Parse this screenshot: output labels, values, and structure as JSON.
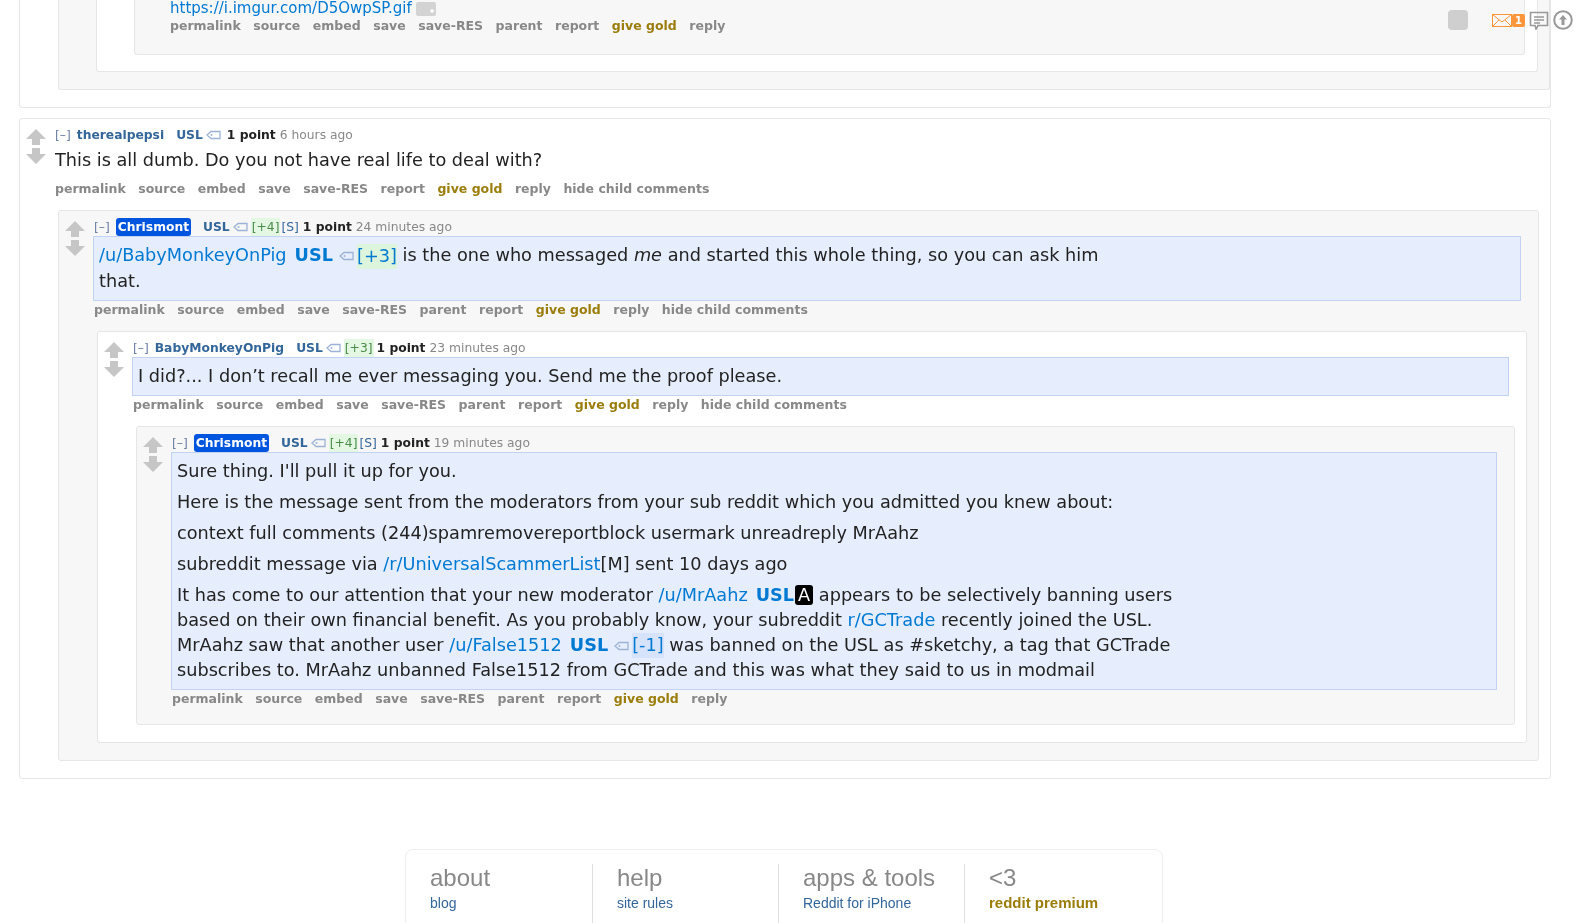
{
  "dock": {
    "mail_count": "1"
  },
  "previous_comment_tail": {
    "link": "https://i.imgur.com/D5OwpSP.gif",
    "actions": [
      {
        "text": "permalink",
        "kind": "plain"
      },
      {
        "text": "source",
        "kind": "plain"
      },
      {
        "text": "embed",
        "kind": "plain"
      },
      {
        "text": "save",
        "kind": "plain"
      },
      {
        "text": "save-RES",
        "kind": "plain"
      },
      {
        "text": "parent",
        "kind": "plain"
      },
      {
        "text": "report",
        "kind": "plain"
      },
      {
        "text": "give gold",
        "kind": "gold"
      },
      {
        "text": "reply",
        "kind": "plain"
      }
    ]
  },
  "comments": [
    {
      "collapse": "[–]",
      "author": "therealpepsi",
      "author_highlight": false,
      "flair": "USL",
      "score": "1 point",
      "time": "6 hours ago",
      "body_highlight": false,
      "body": [
        [
          {
            "kind": "text",
            "text": "This is all dumb. Do you not have real life to deal with?"
          }
        ]
      ],
      "actions": [
        {
          "text": "permalink",
          "kind": "plain"
        },
        {
          "text": "source",
          "kind": "plain"
        },
        {
          "text": "embed",
          "kind": "plain"
        },
        {
          "text": "save",
          "kind": "plain"
        },
        {
          "text": "save-RES",
          "kind": "plain"
        },
        {
          "text": "report",
          "kind": "plain"
        },
        {
          "text": "give gold",
          "kind": "gold"
        },
        {
          "text": "reply",
          "kind": "plain"
        },
        {
          "text": "hide child comments",
          "kind": "plain"
        }
      ],
      "children": [
        {
          "collapse": "[–]",
          "author": "Chrismont",
          "author_highlight": true,
          "flair": "USL",
          "karma": [
            {
              "text": "[+4]",
              "kind": "plus"
            },
            {
              "text": "[S]",
              "kind": "flag"
            }
          ],
          "score": "1 point",
          "time": "24 minutes ago",
          "body_highlight": true,
          "body": [
            [
              {
                "kind": "link",
                "text": "/u/BabyMonkeyOnPig"
              },
              {
                "kind": "flair",
                "text": "USL"
              },
              {
                "kind": "karma",
                "karma": {
                  "kind": "plus",
                  "text": "[+3]"
                }
              },
              {
                "kind": "text",
                "text": " is the one who messaged *me* and started this whole thing, so you can ask him that."
              }
            ]
          ],
          "actions": [
            {
              "text": "permalink",
              "kind": "plain"
            },
            {
              "text": "source",
              "kind": "plain"
            },
            {
              "text": "embed",
              "kind": "plain"
            },
            {
              "text": "save",
              "kind": "plain"
            },
            {
              "text": "save-RES",
              "kind": "plain"
            },
            {
              "text": "parent",
              "kind": "plain"
            },
            {
              "text": "report",
              "kind": "plain"
            },
            {
              "text": "give gold",
              "kind": "gold"
            },
            {
              "text": "reply",
              "kind": "plain"
            },
            {
              "text": "hide child comments",
              "kind": "plain"
            }
          ],
          "children": [
            {
              "collapse": "[–]",
              "author": "BabyMonkeyOnPig",
              "author_highlight": false,
              "flair": "USL",
              "karma": [
                {
                  "text": "[+3]",
                  "kind": "plus"
                }
              ],
              "score": "1 point",
              "time": "23 minutes ago",
              "body_highlight": true,
              "body": [
                [
                  {
                    "kind": "text",
                    "text": "I did?... I don’t recall me ever messaging you. Send me the proof please."
                  }
                ]
              ],
              "actions": [
                {
                  "text": "permalink",
                  "kind": "plain"
                },
                {
                  "text": "source",
                  "kind": "plain"
                },
                {
                  "text": "embed",
                  "kind": "plain"
                },
                {
                  "text": "save",
                  "kind": "plain"
                },
                {
                  "text": "save-RES",
                  "kind": "plain"
                },
                {
                  "text": "parent",
                  "kind": "plain"
                },
                {
                  "text": "report",
                  "kind": "plain"
                },
                {
                  "text": "give gold",
                  "kind": "gold"
                },
                {
                  "text": "reply",
                  "kind": "plain"
                },
                {
                  "text": "hide child comments",
                  "kind": "plain"
                }
              ],
              "children": [
                {
                  "collapse": "[–]",
                  "author": "Chrismont",
                  "author_highlight": true,
                  "flair": "USL",
                  "karma": [
                    {
                      "text": "[+4]",
                      "kind": "plus"
                    },
                    {
                      "text": "[S]",
                      "kind": "flag"
                    }
                  ],
                  "score": "1 point",
                  "time": "19 minutes ago",
                  "body_highlight": true,
                  "body": [
                    [
                      {
                        "kind": "text",
                        "text": "Sure thing. I'll pull it up for you."
                      }
                    ],
                    [
                      {
                        "kind": "text",
                        "text": "Here is the message sent from the moderators from your sub reddit which you admitted you knew about:"
                      }
                    ],
                    [
                      {
                        "kind": "text",
                        "text": "context full comments (244)spamremovereportblock usermark unreadreply MrAahz"
                      }
                    ],
                    [
                      {
                        "kind": "text",
                        "text": "subreddit message via "
                      },
                      {
                        "kind": "link",
                        "text": "/r/UniversalScammerList"
                      },
                      {
                        "kind": "text",
                        "text": "[M] sent 10 days ago"
                      }
                    ],
                    [
                      {
                        "kind": "text",
                        "text": "It has come to our attention that your new moderator "
                      },
                      {
                        "kind": "link",
                        "text": "/u/MrAahz"
                      },
                      {
                        "kind": "flair",
                        "text": "USL"
                      },
                      {
                        "kind": "badge",
                        "text": "A"
                      },
                      {
                        "kind": "text",
                        "text": " appears to be selectively banning users based on their own financial benefit. As you probably know, your subreddit "
                      },
                      {
                        "kind": "link",
                        "text": "r/GCTrade"
                      },
                      {
                        "kind": "text",
                        "text": " recently joined the USL. MrAahz saw that another user "
                      },
                      {
                        "kind": "link",
                        "text": "/u/False1512"
                      },
                      {
                        "kind": "flair",
                        "text": "USL"
                      },
                      {
                        "kind": "karma",
                        "karma": {
                          "kind": "minus",
                          "text": "[-1]"
                        }
                      },
                      {
                        "kind": "text",
                        "text": " was banned on the USL as #sketchy, a tag that GCTrade subscribes to. MrAahz unbanned False1512 from GCTrade and this was what they said to us in modmail"
                      }
                    ]
                  ],
                  "actions": [
                    {
                      "text": "permalink",
                      "kind": "plain"
                    },
                    {
                      "text": "source",
                      "kind": "plain"
                    },
                    {
                      "text": "embed",
                      "kind": "plain"
                    },
                    {
                      "text": "save",
                      "kind": "plain"
                    },
                    {
                      "text": "save-RES",
                      "kind": "plain"
                    },
                    {
                      "text": "parent",
                      "kind": "plain"
                    },
                    {
                      "text": "report",
                      "kind": "plain"
                    },
                    {
                      "text": "give gold",
                      "kind": "gold"
                    },
                    {
                      "text": "reply",
                      "kind": "plain"
                    }
                  ]
                }
              ]
            }
          ]
        }
      ]
    }
  ],
  "footer": {
    "columns": [
      {
        "heading": "about",
        "links": [
          {
            "text": "blog",
            "kind": "plain"
          }
        ]
      },
      {
        "heading": "help",
        "links": [
          {
            "text": "site rules",
            "kind": "plain"
          }
        ]
      },
      {
        "heading": "apps & tools",
        "links": [
          {
            "text": "Reddit for iPhone",
            "kind": "plain"
          }
        ]
      },
      {
        "heading": "<3",
        "links": [
          {
            "text": "reddit premium",
            "kind": "gold"
          }
        ]
      }
    ]
  }
}
